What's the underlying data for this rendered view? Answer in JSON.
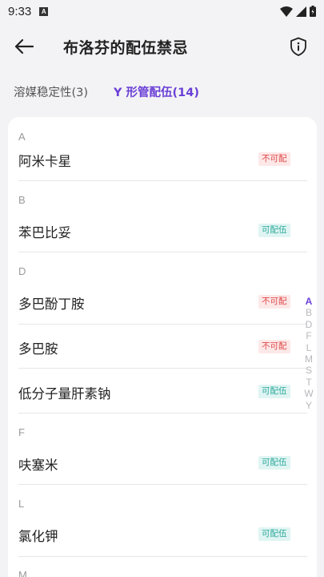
{
  "status_bar": {
    "time": "9:33",
    "app_icon": "A",
    "icons": [
      "wifi-icon",
      "cell-signal-icon",
      "battery-icon"
    ]
  },
  "header": {
    "title": "布洛芬的配伍禁忌",
    "back_icon": "arrow-left-icon",
    "info_icon": "shield-info-icon"
  },
  "tabs": [
    {
      "label": "溶媒稳定性(3)",
      "active": false
    },
    {
      "label": "Y 形管配伍(14)",
      "active": true
    }
  ],
  "sections": [
    {
      "letter": "A",
      "items": [
        {
          "name": "阿米卡星",
          "badge": "不可配",
          "status": "incompatible"
        }
      ]
    },
    {
      "letter": "B",
      "items": [
        {
          "name": "苯巴比妥",
          "badge": "可配伍",
          "status": "compatible"
        }
      ]
    },
    {
      "letter": "D",
      "items": [
        {
          "name": "多巴酚丁胺",
          "badge": "不可配",
          "status": "incompatible"
        },
        {
          "name": "多巴胺",
          "badge": "不可配",
          "status": "incompatible"
        },
        {
          "name": "低分子量肝素钠",
          "badge": "可配伍",
          "status": "compatible"
        }
      ]
    },
    {
      "letter": "F",
      "items": [
        {
          "name": "呋塞米",
          "badge": "可配伍",
          "status": "compatible"
        }
      ]
    },
    {
      "letter": "L",
      "items": [
        {
          "name": "氯化钾",
          "badge": "可配伍",
          "status": "compatible"
        }
      ]
    },
    {
      "letter": "M",
      "items": []
    }
  ],
  "index_bar": {
    "letters": [
      "A",
      "B",
      "D",
      "F",
      "L",
      "M",
      "S",
      "T",
      "W",
      "Y"
    ],
    "active": "A"
  },
  "colors": {
    "accent": "#6a3fd6",
    "incompatible_text": "#e04848",
    "incompatible_bg": "#fde8e8",
    "compatible_text": "#2aa79a",
    "compatible_bg": "#e0f5f3",
    "background": "#f3f3f5"
  }
}
